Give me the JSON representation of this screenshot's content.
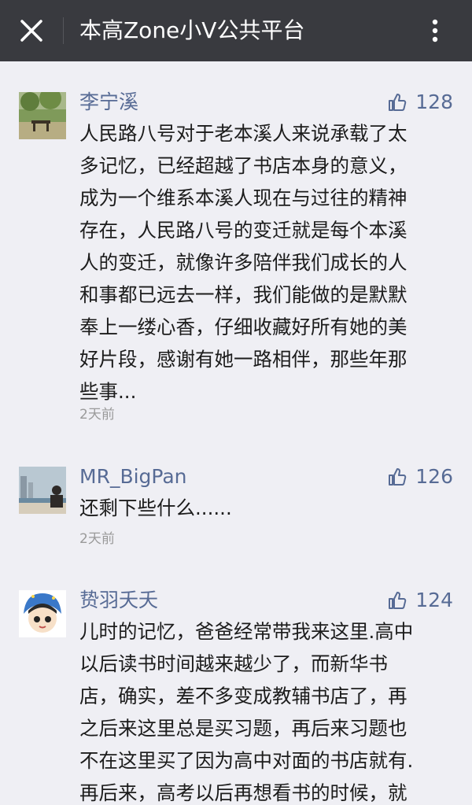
{
  "topbar": {
    "title": "本高Zone小V公共平台",
    "close_icon": "close-icon",
    "more_icon": "more-vertical-icon"
  },
  "colors": {
    "topbar_bg": "#393a3f",
    "page_bg": "#efeff4",
    "name_color": "#576b95"
  },
  "comments": [
    {
      "name": "李宁溪",
      "likes": "128",
      "content": "人民路八号对于老本溪人来说承载了太\n多记忆，已经超越了书店本身的意义，\n成为一个维系本溪人现在与过往的精神\n存在，人民路八号的变迁就是每个本溪\n人的变迁，就像许多陪伴我们成长的人\n和事都已远去一样，我们能做的是默默\n奉上一缕心香，仔细收藏好所有她的美\n好片段，感谢有她一路相伴，那些年那\n些事...",
      "time": "2天前"
    },
    {
      "name": "MR_BigPan",
      "likes": "126",
      "content": "还剩下些什么......",
      "time": "2天前"
    },
    {
      "name": "贽羽夭夭",
      "likes": "124",
      "content": "儿时的记忆，爸爸经常带我来这里.高中\n以后读书时间越来越少了，而新华书\n店，确实，差不多变成教辅书店了，再\n之后来这里总是买习题，再后来习题也\n不在这里买了因为高中对面的书店就有.\n再后来，高考以后再想看书的时候，就",
      "time": ""
    }
  ]
}
